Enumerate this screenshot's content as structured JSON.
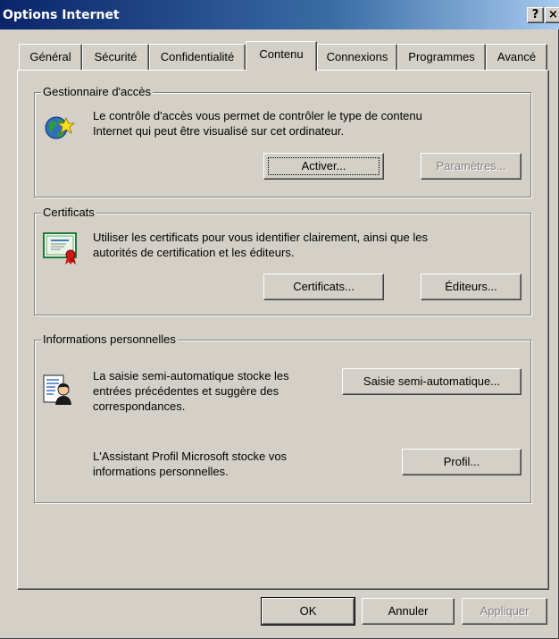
{
  "window": {
    "title": "Options Internet",
    "help_label": "?",
    "close_label": "×"
  },
  "tabs": [
    {
      "label": "Général"
    },
    {
      "label": "Sécurité"
    },
    {
      "label": "Confidentialité"
    },
    {
      "label": "Contenu",
      "active": true
    },
    {
      "label": "Connexions"
    },
    {
      "label": "Programmes"
    },
    {
      "label": "Avancé"
    }
  ],
  "content_advisor": {
    "title": "Gestionnaire d'accès",
    "description_line1": "Le contrôle d'accès vous permet de contrôler le type de contenu",
    "description_line2": "Internet qui peut être visualisé sur cet ordinateur.",
    "enable_label": "Activer...",
    "settings_label": "Paramètres...",
    "icon": "globe-star-icon"
  },
  "certificates": {
    "title": "Certificats",
    "description_line1": "Utiliser les certificats pour vous identifier clairement, ainsi que les",
    "description_line2": "autorités de certification et les éditeurs.",
    "certificates_label": "Certificats...",
    "publishers_label": "Éditeurs...",
    "icon": "certificate-icon"
  },
  "personal_info": {
    "title": "Informations personnelles",
    "autocomplete_line1": "La saisie semi-automatique stocke les",
    "autocomplete_line2": "entrées précédentes et suggère des",
    "autocomplete_line3": "correspondances.",
    "autocomplete_label": "Saisie semi-automatique...",
    "profile_line1": "L'Assistant Profil Microsoft stocke vos",
    "profile_line2": "informations personnelles.",
    "profile_label": "Profil...",
    "icon": "profile-document-icon"
  },
  "footer": {
    "ok_label": "OK",
    "cancel_label": "Annuler",
    "apply_label": "Appliquer"
  },
  "colors": {
    "title_bar_start": "#0a246a",
    "title_bar_end": "#a6caf0",
    "face": "#d4d0c8"
  }
}
